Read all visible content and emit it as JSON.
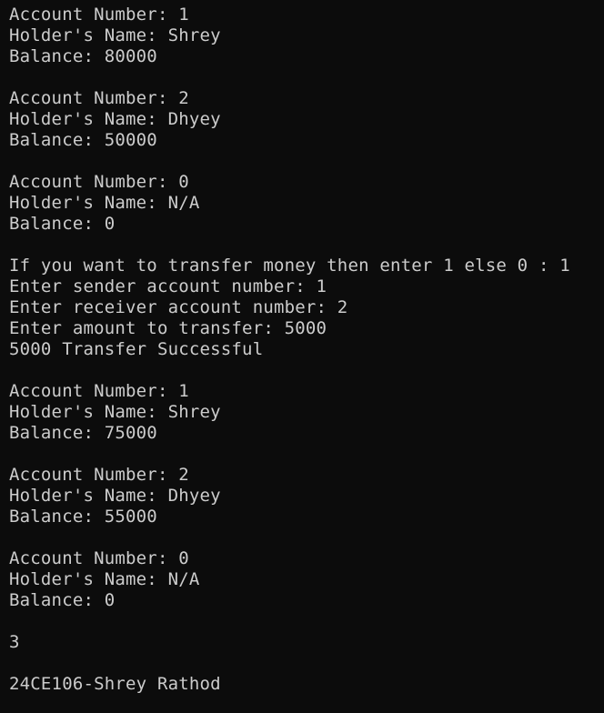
{
  "terminal": {
    "lines": [
      "Account Number: 1",
      "Holder's Name: Shrey",
      "Balance: 80000",
      "",
      "Account Number: 2",
      "Holder's Name: Dhyey",
      "Balance: 50000",
      "",
      "Account Number: 0",
      "Holder's Name: N/A",
      "Balance: 0",
      "",
      "If you want to transfer money then enter 1 else 0 : 1",
      "Enter sender account number: 1",
      "Enter receiver account number: 2",
      "Enter amount to transfer: 5000",
      "5000 Transfer Successful",
      "",
      "Account Number: 1",
      "Holder's Name: Shrey",
      "Balance: 75000",
      "",
      "Account Number: 2",
      "Holder's Name: Dhyey",
      "Balance: 55000",
      "",
      "Account Number: 0",
      "Holder's Name: N/A",
      "Balance: 0",
      "",
      "3",
      "",
      "24CE106-Shrey Rathod"
    ]
  }
}
